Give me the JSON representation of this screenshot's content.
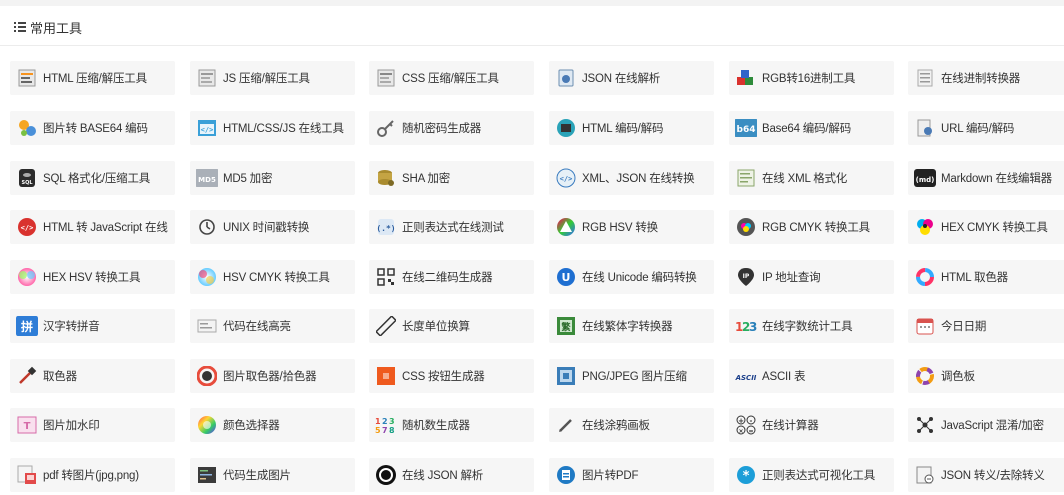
{
  "section": {
    "title": "常用工具"
  },
  "colors": {
    "background": "#f3f3f3",
    "panel": "#ffffff",
    "card": "#f6f6f6",
    "text": "#333333"
  },
  "tools": [
    [
      {
        "label": "HTML 压缩/解压工具",
        "icon": "html-compress-icon"
      },
      {
        "label": "JS 压缩/解压工具",
        "icon": "js-compress-icon"
      },
      {
        "label": "CSS 压缩/解压工具",
        "icon": "css-compress-icon"
      },
      {
        "label": "JSON 在线解析",
        "icon": "json-parse-icon"
      },
      {
        "label": "RGB转16进制工具",
        "icon": "rgb-hex-icon"
      },
      {
        "label": "在线进制转换器",
        "icon": "base-convert-icon"
      }
    ],
    [
      {
        "label": "图片转 BASE64 编码",
        "icon": "image-base64-icon"
      },
      {
        "label": "HTML/CSS/JS 在线工具",
        "icon": "web-tool-icon"
      },
      {
        "label": "随机密码生成器",
        "icon": "key-icon"
      },
      {
        "label": "HTML 编码/解码",
        "icon": "html-encode-icon"
      },
      {
        "label": "Base64 编码/解码",
        "icon": "base64-icon"
      },
      {
        "label": "URL 编码/解码",
        "icon": "url-encode-icon"
      }
    ],
    [
      {
        "label": "SQL 格式化/压缩工具",
        "icon": "sql-icon"
      },
      {
        "label": "MD5 加密",
        "icon": "md5-icon"
      },
      {
        "label": "SHA 加密",
        "icon": "sha-database-icon"
      },
      {
        "label": "XML、JSON 在线转换",
        "icon": "xml-json-icon"
      },
      {
        "label": "在线 XML 格式化",
        "icon": "xml-format-icon"
      },
      {
        "label": "Markdown 在线编辑器",
        "icon": "markdown-icon"
      }
    ],
    [
      {
        "label": "HTML 转 JavaScript 在线",
        "icon": "html-js-icon"
      },
      {
        "label": "UNIX 时间戳转换",
        "icon": "clock-history-icon"
      },
      {
        "label": "正则表达式在线测试",
        "icon": "regex-test-icon"
      },
      {
        "label": "RGB HSV 转换",
        "icon": "rgb-hsv-icon"
      },
      {
        "label": "RGB CMYK 转换工具",
        "icon": "rgb-cmyk-icon"
      },
      {
        "label": "HEX CMYK 转换工具",
        "icon": "hex-cmyk-icon"
      }
    ],
    [
      {
        "label": "HEX HSV 转换工具",
        "icon": "hex-hsv-icon"
      },
      {
        "label": "HSV CMYK 转换工具",
        "icon": "hsv-cmyk-icon"
      },
      {
        "label": "在线二维码生成器",
        "icon": "qrcode-icon"
      },
      {
        "label": "在线 Unicode 编码转换",
        "icon": "unicode-icon"
      },
      {
        "label": "IP 地址查询",
        "icon": "ip-location-icon"
      },
      {
        "label": "HTML 取色器",
        "icon": "color-ring-icon"
      }
    ],
    [
      {
        "label": "汉字转拼音",
        "icon": "pinyin-icon"
      },
      {
        "label": "代码在线高亮",
        "icon": "code-highlight-icon"
      },
      {
        "label": "长度单位换算",
        "icon": "ruler-icon"
      },
      {
        "label": "在线繁体字转换器",
        "icon": "traditional-chinese-icon"
      },
      {
        "label": "在线字数统计工具",
        "icon": "count-123-icon"
      },
      {
        "label": "今日日期",
        "icon": "calendar-icon"
      }
    ],
    [
      {
        "label": "取色器",
        "icon": "eyedropper-icon"
      },
      {
        "label": "图片取色器/拾色器",
        "icon": "image-picker-icon"
      },
      {
        "label": "CSS 按钮生成器",
        "icon": "css-button-icon"
      },
      {
        "label": "PNG/JPEG 图片压缩",
        "icon": "image-compress-icon"
      },
      {
        "label": "ASCII 表",
        "icon": "ascii-icon"
      },
      {
        "label": "调色板",
        "icon": "palette-ring-icon"
      }
    ],
    [
      {
        "label": "图片加水印",
        "icon": "watermark-icon"
      },
      {
        "label": "颜色选择器",
        "icon": "color-wheel-icon"
      },
      {
        "label": "随机数生成器",
        "icon": "random-number-icon"
      },
      {
        "label": "在线涂鸦画板",
        "icon": "pencil-icon"
      },
      {
        "label": "在线计算器",
        "icon": "calculator-icon"
      },
      {
        "label": "JavaScript 混淆/加密",
        "icon": "js-obfuscate-icon"
      }
    ],
    [
      {
        "label": "pdf 转图片(jpg,png)",
        "icon": "pdf-image-icon"
      },
      {
        "label": "代码生成图片",
        "icon": "code-image-icon"
      },
      {
        "label": "在线 JSON 解析",
        "icon": "json-circle-icon"
      },
      {
        "label": "图片转PDF",
        "icon": "image-pdf-icon"
      },
      {
        "label": "正则表达式可视化工具",
        "icon": "regex-visual-icon"
      },
      {
        "label": "JSON 转义/去除转义",
        "icon": "json-escape-icon"
      }
    ]
  ]
}
